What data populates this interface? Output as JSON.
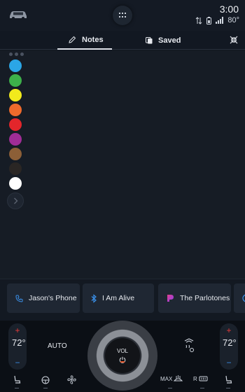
{
  "status": {
    "time": "3:00",
    "temperature": "80°"
  },
  "tabs": {
    "notes_label": "Notes",
    "saved_label": "Saved",
    "active": "Notes"
  },
  "palette": {
    "colors": [
      "#2ba6e6",
      "#3db04a",
      "#f2ea1c",
      "#ee6a2c",
      "#e3262b",
      "#a02d96",
      "#8c5f37",
      "#2a2624",
      "#ffffff"
    ]
  },
  "media": {
    "items": [
      {
        "label": "Jason's Phone",
        "icon": "phone-icon"
      },
      {
        "label": "I Am Alive",
        "icon": "bluetooth-icon"
      },
      {
        "label": "The Parlotones",
        "icon": "pandora-icon"
      }
    ]
  },
  "climate": {
    "left_temp": "72°",
    "right_temp": "72°",
    "auto_label": "AUTO",
    "volume_label": "VOL",
    "max_label": "MAX",
    "rear_label": "R"
  }
}
